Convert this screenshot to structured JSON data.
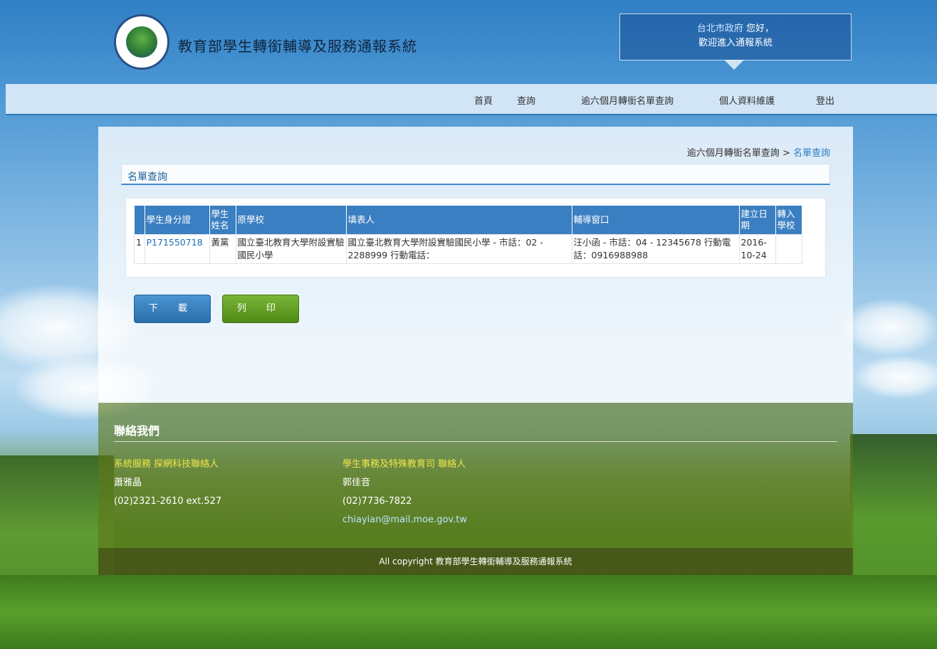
{
  "header": {
    "site_title": "教育部學生轉銜輔導及服務通報系統",
    "logo_alt_text": "MINISTRY OF EDUCATION",
    "welcome_org": "台北市政府",
    "welcome_greeting": "您好，",
    "welcome_line2": "歡迎進入通報系統"
  },
  "nav": {
    "items": [
      "首頁",
      "查詢",
      "逾六個月轉銜名單查詢",
      "個人資料維護",
      "登出"
    ]
  },
  "breadcrumb": {
    "parent": "逾六個月轉銜名單查詢",
    "separator": " > ",
    "current": "名單查詢"
  },
  "section": {
    "title": "名單查詢"
  },
  "table": {
    "headers": [
      "學生身分證",
      "學生姓名",
      "原學校",
      "填表人",
      "輔導窗口",
      "建立日期",
      "轉入學校"
    ],
    "rows": [
      {
        "index": "1",
        "id": "P171550718",
        "name": "黃黨",
        "school": "國立臺北教育大學附設實驗國民小學",
        "filler": "國立臺北教育大學附設實驗國民小學 - 市話：02 - 2288999 行動電話：",
        "contact": "汪小函 - 市話：04 - 12345678 行動電話：0916988988",
        "date": "2016-10-24",
        "transfer": ""
      }
    ]
  },
  "buttons": {
    "download": "下 載",
    "print": "列 印"
  },
  "footer": {
    "title": "聯絡我們",
    "col1": {
      "title": "系統服務 探網科技聯絡人",
      "name": "蕭雅晶",
      "phone": "(02)2321-2610 ext.527"
    },
    "col2": {
      "title": "學生事務及特殊教育司 聯絡人",
      "name": "郭佳音",
      "phone": "(02)7736-7822",
      "email": "chiayian@mail.moe.gov.tw"
    },
    "copyright": "All copyright 教育部學生轉銜輔導及服務通報系統"
  },
  "colors": {
    "nav_accent": "#2d78b8",
    "table_header": "#3a7fc1",
    "download_button": "#2a6fab",
    "print_button": "#4f8a17",
    "footer_title_yellow": "#f0e64a"
  }
}
